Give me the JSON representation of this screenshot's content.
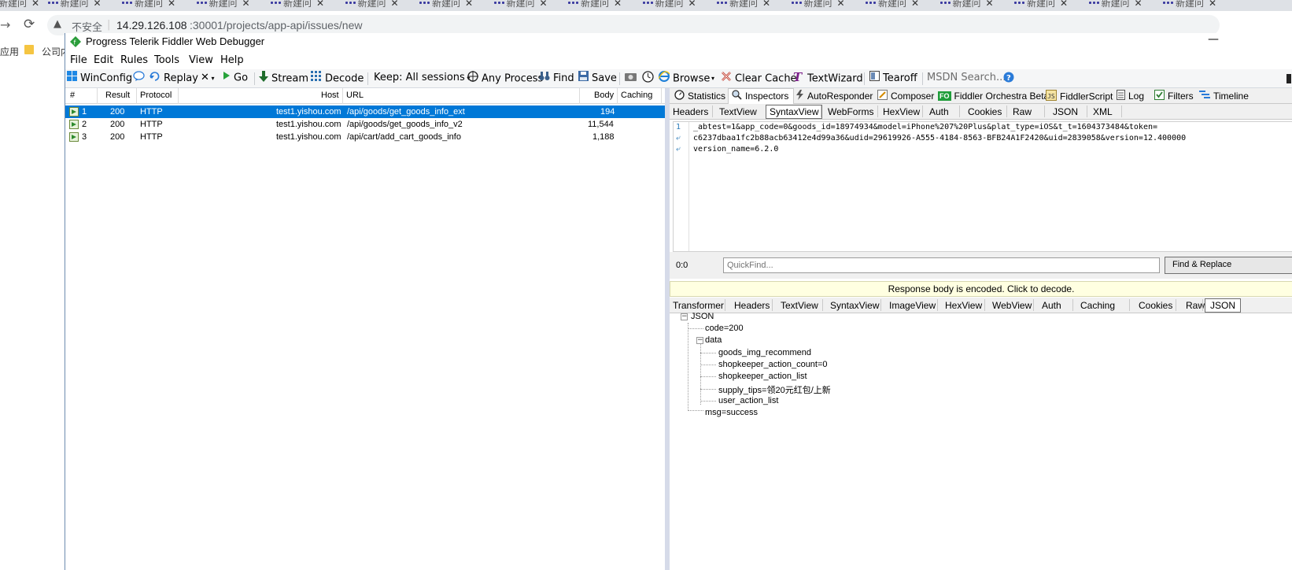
{
  "browser": {
    "tab_title": "新建问",
    "tab_titles": [
      "新建问",
      "新建问",
      "新建问",
      "新建问",
      "新建问",
      "新建问",
      "新建问",
      "新建问",
      "新建问",
      "新建问",
      "新建问",
      "新建问",
      "新建问",
      "新建问",
      "新建问",
      "新建问",
      "新建问"
    ],
    "security_label": "不安全",
    "url_host": "14.29.126.108",
    "url_path": ":30001/projects/app-api/issues/new",
    "bookmark_left": "应用",
    "bookmark_folder": "公司内"
  },
  "fiddler": {
    "title": "Progress Telerik Fiddler Web Debugger",
    "menu": [
      "File",
      "Edit",
      "Rules",
      "Tools",
      "View",
      "Help"
    ],
    "toolbar": {
      "winconfig": "WinConfig",
      "replay": "Replay",
      "go": "Go",
      "stream": "Stream",
      "decode": "Decode",
      "keep": "Keep: All sessions",
      "any_process": "Any Process",
      "find": "Find",
      "save": "Save",
      "browse": "Browse",
      "clear_cache": "Clear Cache",
      "textwizard": "TextWizard",
      "tearoff": "Tearoff",
      "msdn_search": "MSDN Search..."
    },
    "sessions": {
      "columns": [
        "#",
        "Result",
        "Protocol",
        "Host",
        "URL",
        "Body",
        "Caching"
      ],
      "rows": [
        {
          "num": "1",
          "result": "200",
          "protocol": "HTTP",
          "host": "test1.yishou.com",
          "url": "/api/goods/get_goods_info_ext",
          "body": "194",
          "caching": "",
          "selected": true
        },
        {
          "num": "2",
          "result": "200",
          "protocol": "HTTP",
          "host": "test1.yishou.com",
          "url": "/api/goods/get_goods_info_v2",
          "body": "11,544",
          "caching": "",
          "selected": false
        },
        {
          "num": "3",
          "result": "200",
          "protocol": "HTTP",
          "host": "test1.yishou.com",
          "url": "/api/cart/add_cart_goods_info",
          "body": "1,188",
          "caching": "",
          "selected": false
        }
      ]
    },
    "inspector_tabs": [
      "Statistics",
      "Inspectors",
      "AutoResponder",
      "Composer",
      "Fiddler Orchestra Beta",
      "FiddlerScript",
      "Log",
      "Filters",
      "Timeline"
    ],
    "fo_badge": "FO",
    "request_tabs": [
      "Headers",
      "TextView",
      "SyntaxView",
      "WebForms",
      "HexView",
      "Auth",
      "Cookies",
      "Raw",
      "JSON",
      "XML"
    ],
    "request_text": {
      "lines": [
        "_abtest=1&app_code=0&goods_id=18974934&model=iPhone%207%20Plus&plat_type=iOS&t_t=1604373484&token=",
        "c6237dbaa1fc2b88acb63412e4d99a36&udid=29619926-A555-4184-8563-BFB24A1F2420&uid=2839058&version=12.400000",
        "version_name=6.2.0"
      ],
      "line_number": "1"
    },
    "quickfind": {
      "position": "0:0",
      "placeholder": "QuickFind...",
      "button": "Find & Replace"
    },
    "response_notice": "Response body is encoded. Click to decode.",
    "response_tabs": [
      "Transformer",
      "Headers",
      "TextView",
      "SyntaxView",
      "ImageView",
      "HexView",
      "WebView",
      "Auth",
      "Caching",
      "Cookies",
      "Raw",
      "JSON"
    ],
    "json_tree": {
      "root": "JSON",
      "code": "code=200",
      "data": "data",
      "children": [
        "goods_img_recommend",
        "shopkeeper_action_count=0",
        "shopkeeper_action_list",
        "supply_tips=领20元红包/上新",
        "user_action_list"
      ],
      "msg": "msg=success"
    }
  }
}
